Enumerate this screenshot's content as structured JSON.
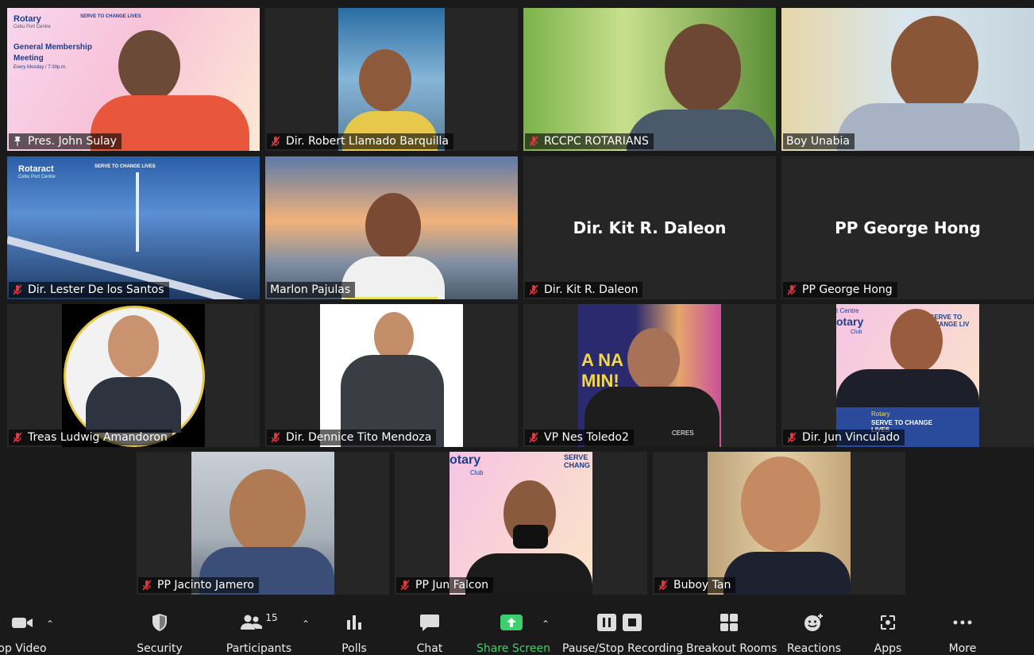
{
  "participants": [
    {
      "name": "Pres. John Sulay",
      "status": "pinned"
    },
    {
      "name": "Dir. Robert Llamado Barquilla",
      "status": "muted"
    },
    {
      "name": "RCCPC ROTARIANS",
      "status": "muted"
    },
    {
      "name": "Boy Unabia",
      "status": "none"
    },
    {
      "name": "Dir. Lester De los Santos",
      "status": "muted"
    },
    {
      "name": "Marlon Pajulas",
      "status": "none"
    },
    {
      "name": "Dir. Kit R. Daleon",
      "status": "muted",
      "display_name": "Dir. Kit R. Daleon"
    },
    {
      "name": "PP George Hong",
      "status": "muted",
      "display_name": "PP George Hong"
    },
    {
      "name": "Treas Ludwig Amandoron",
      "status": "muted"
    },
    {
      "name": "Dir. Dennice Tito Mendoza",
      "status": "muted"
    },
    {
      "name": "VP Nes Toledo2",
      "status": "muted"
    },
    {
      "name": "Dir. Jun Vinculado",
      "status": "muted"
    },
    {
      "name": "PP Jacinto Jamero",
      "status": "muted"
    },
    {
      "name": "PP Jun Falcon",
      "status": "muted"
    },
    {
      "name": "Buboy Tan",
      "status": "muted"
    }
  ],
  "slide": {
    "brand": "Rotary",
    "club": "Cebu Port Centre",
    "tagline": "SERVE TO CHANGE LIVES",
    "title_line1": "General Membership",
    "title_line2": "Meeting",
    "schedule": "Every Monday / 7:30p.m."
  },
  "rotaract": {
    "brand": "Rotaract",
    "club": "Cebu Port Centre",
    "tagline": "SERVE TO CHANGE LIVES"
  },
  "vinculado_bg": {
    "club": "t Centre",
    "brand": "otary",
    "sub": "Club",
    "tagline": "SERVE TO CHANGE LIV",
    "badge": "Rotary",
    "badge_tag": "SERVE TO CHANGE LIVES"
  },
  "falcon_bg": {
    "brand": "otary",
    "sub": "Club",
    "tagline": "SERVE CHANG"
  },
  "toledo_bg": {
    "text1": "A NA",
    "text2": "MIN!",
    "shirt": "CERES"
  },
  "toolbar": {
    "stop_video": "op Video",
    "security": "Security",
    "participants": "Participants",
    "participants_count": "15",
    "polls": "Polls",
    "chat": "Chat",
    "share_screen": "Share Screen",
    "recording": "Pause/Stop Recording",
    "breakout": "Breakout Rooms",
    "reactions": "Reactions",
    "apps": "Apps",
    "more": "More"
  },
  "colors": {
    "active_border": "#e6e35a",
    "share_green": "#3ccf6e",
    "mute_red": "#e0383e",
    "bg": "#1a1a1a",
    "tile": "#262626"
  }
}
